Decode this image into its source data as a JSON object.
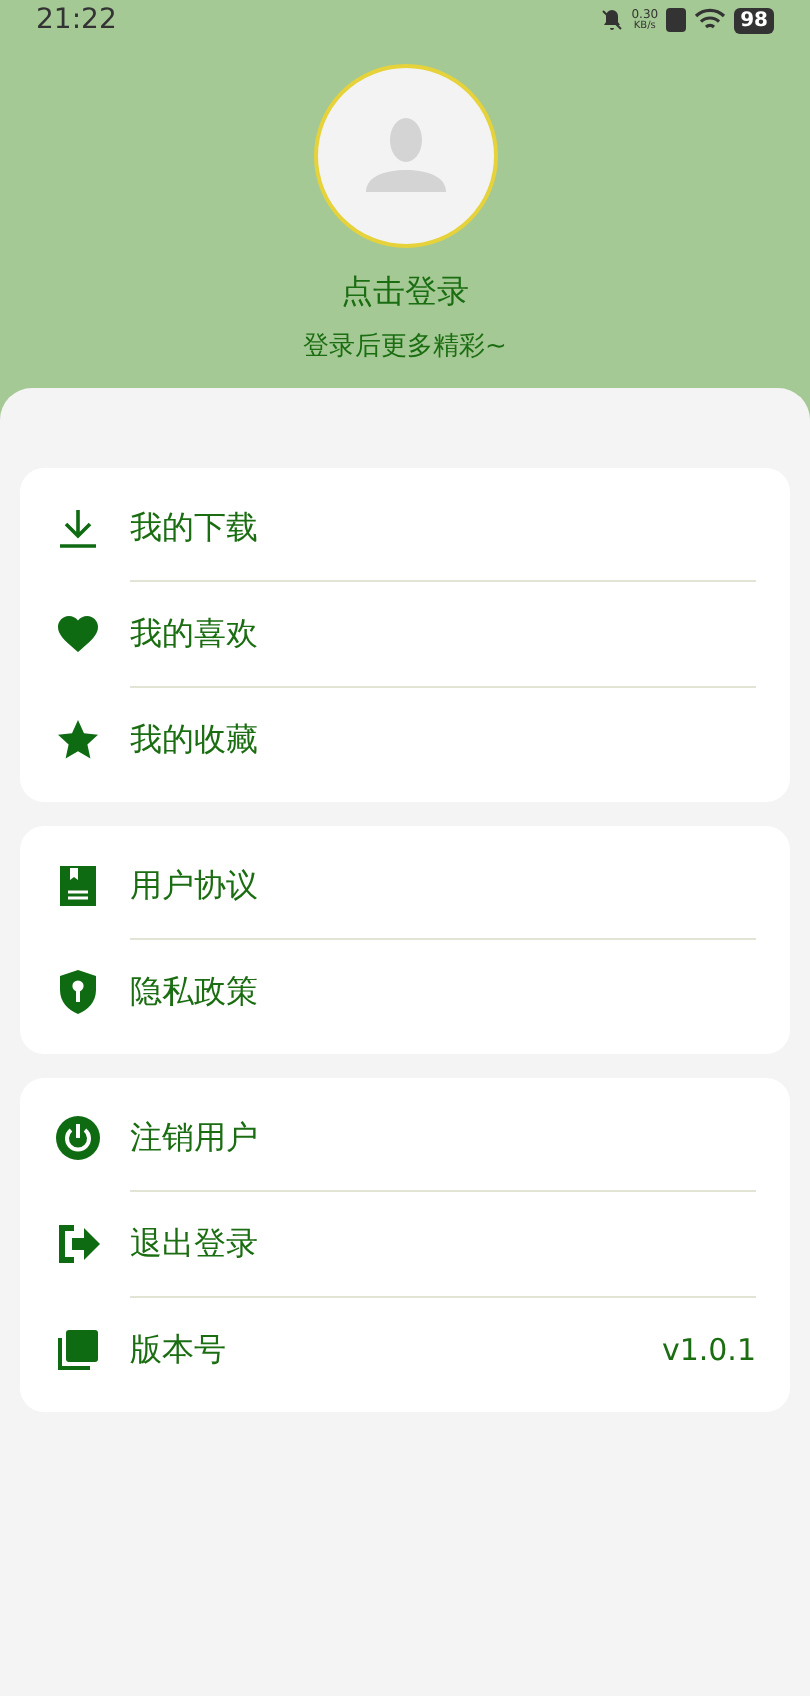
{
  "status_bar": {
    "time": "21:22",
    "speed": "0.30",
    "speed_unit": "KB/s",
    "battery": "98"
  },
  "profile": {
    "title": "点击登录",
    "subtitle": "登录后更多精彩~"
  },
  "groups": [
    {
      "items": [
        {
          "kind": "download",
          "label": "我的下载"
        },
        {
          "kind": "heart",
          "label": "我的喜欢"
        },
        {
          "kind": "star",
          "label": "我的收藏"
        }
      ]
    },
    {
      "items": [
        {
          "kind": "book",
          "label": "用户协议"
        },
        {
          "kind": "shield",
          "label": "隐私政策"
        }
      ]
    },
    {
      "items": [
        {
          "kind": "power",
          "label": "注销用户"
        },
        {
          "kind": "logout",
          "label": "退出登录"
        },
        {
          "kind": "version",
          "label": "版本号",
          "value": "v1.0.1"
        }
      ]
    }
  ]
}
